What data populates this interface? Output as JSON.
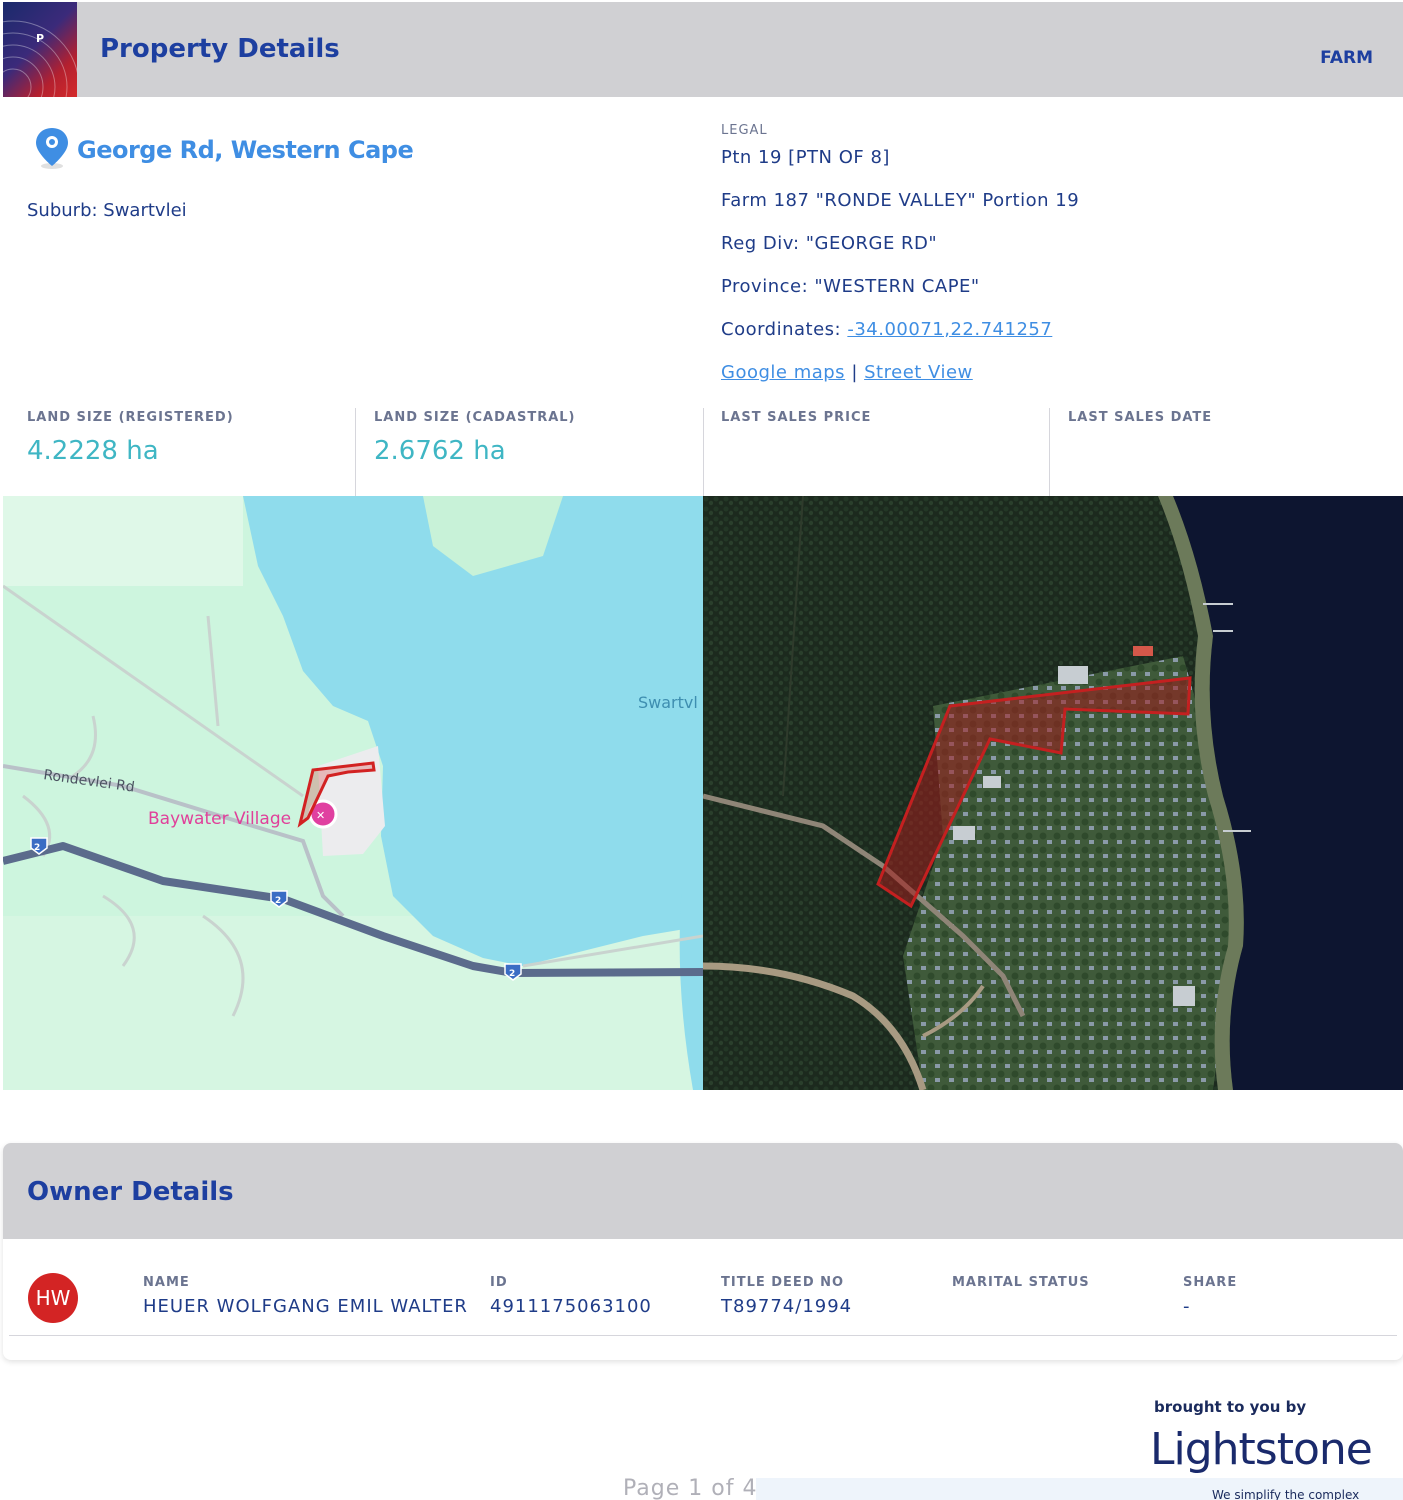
{
  "header": {
    "logo_letter": "P",
    "title": "Property Details",
    "type": "FARM",
    "colors": {
      "bar": "#d0d0d3",
      "title": "#1d3fa0"
    }
  },
  "address": {
    "icon": "map-pin-icon",
    "title": "George Rd, Western Cape",
    "suburb": "Suburb: Swartvlei"
  },
  "legal": {
    "label": "LEGAL",
    "lines": [
      "Ptn 19 [PTN OF 8]",
      "Farm 187 \"RONDE VALLEY\" Portion 19",
      "Reg Div: \"GEORGE RD\"",
      "Province: \"WESTERN CAPE\""
    ],
    "coordinates_label": "Coordinates:",
    "coordinates_value": "-34.00071,22.741257",
    "google_maps": "Google maps",
    "separator": "|",
    "street_view": "Street View"
  },
  "stats": [
    {
      "label": "LAND SIZE (REGISTERED)",
      "value": "4.2228 ha"
    },
    {
      "label": "LAND SIZE (CADASTRAL)",
      "value": "2.6762 ha"
    },
    {
      "label": "LAST SALES PRICE",
      "value": ""
    },
    {
      "label": "LAST SALES DATE",
      "value": ""
    }
  ],
  "map": {
    "road_label": "Rondevlei Rd",
    "poi_label": "Baywater Village",
    "water_label": "Swartvl",
    "route_number": "2",
    "colors": {
      "land": "#cdf5de",
      "water": "#8fdcec",
      "road": "#5b6b8c",
      "parcel": "#d22222"
    }
  },
  "owner": {
    "title": "Owner Details",
    "initials": "HW",
    "columns": [
      {
        "label": "NAME",
        "value": "HEUER WOLFGANG EMIL WALTER"
      },
      {
        "label": "ID",
        "value": "4911175063100"
      },
      {
        "label": "TITLE DEED NO",
        "value": "T89774/1994"
      },
      {
        "label": "MARITAL STATUS",
        "value": ""
      },
      {
        "label": "SHARE",
        "value": "-"
      }
    ]
  },
  "footer": {
    "brought": "brought to you by",
    "brand": "Lightstone",
    "tagline": "We simplify the complex",
    "page": "Page 1 of 4",
    "bar_colors": [
      "#d32424",
      "#f2b41b",
      "#7a8a8a",
      "#1a2a6c"
    ]
  }
}
